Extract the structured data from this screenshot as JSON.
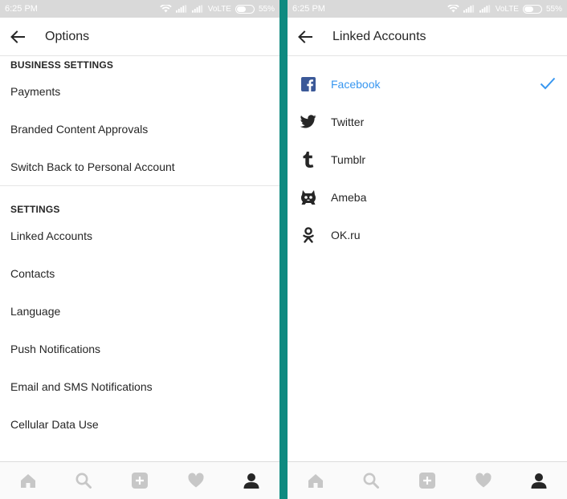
{
  "left": {
    "status": {
      "time": "6:25 PM",
      "network": "VoLTE",
      "battery": "55%"
    },
    "header": {
      "title": "Options"
    },
    "sections": [
      {
        "header": "BUSINESS SETTINGS",
        "items": [
          "Payments",
          "Branded Content Approvals",
          "Switch Back to Personal Account"
        ]
      },
      {
        "header": "SETTINGS",
        "items": [
          "Linked Accounts",
          "Contacts",
          "Language",
          "Push Notifications",
          "Email and SMS Notifications",
          "Cellular Data Use"
        ]
      }
    ]
  },
  "right": {
    "status": {
      "time": "6:25 PM",
      "network": "VoLTE",
      "battery": "55%"
    },
    "header": {
      "title": "Linked Accounts"
    },
    "accounts": [
      {
        "label": "Facebook",
        "icon": "facebook-icon",
        "linked": true
      },
      {
        "label": "Twitter",
        "icon": "twitter-icon",
        "linked": false
      },
      {
        "label": "Tumblr",
        "icon": "tumblr-icon",
        "linked": false
      },
      {
        "label": "Ameba",
        "icon": "ameba-icon",
        "linked": false
      },
      {
        "label": "OK.ru",
        "icon": "okru-icon",
        "linked": false
      }
    ]
  },
  "nav": {
    "icons": [
      "home-icon",
      "search-icon",
      "add-post-icon",
      "heart-icon",
      "profile-icon"
    ]
  },
  "colors": {
    "accent": "#3897f0",
    "divider": "#0e8a80",
    "status_bar": "#d9d9d9",
    "nav_icon": "#c7c7c7",
    "nav_active": "#262626"
  }
}
